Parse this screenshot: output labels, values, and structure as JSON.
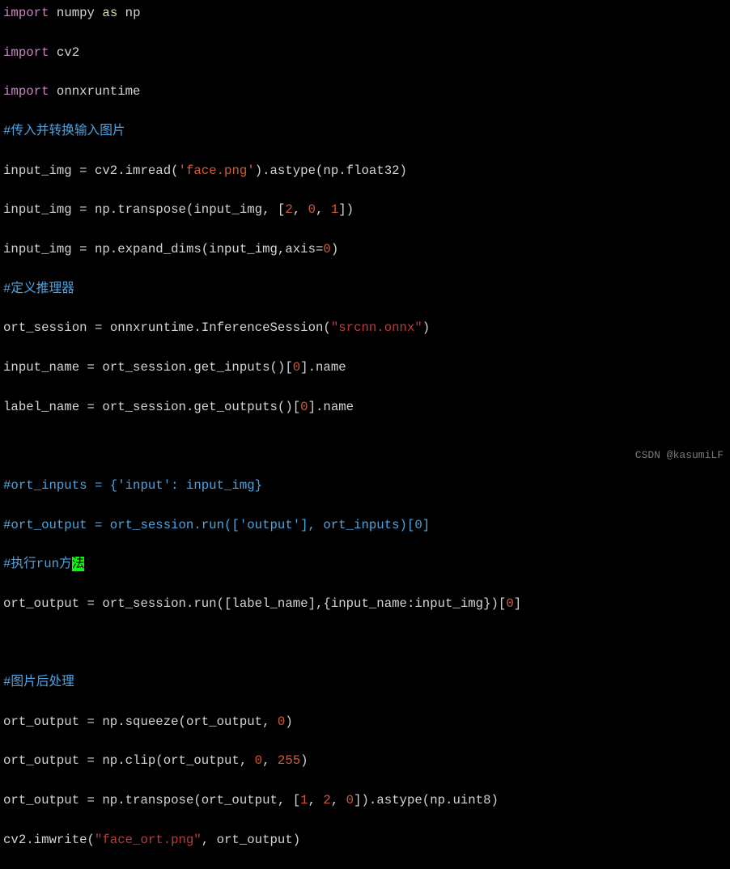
{
  "tokens": {
    "import": "import",
    "as": "as",
    "numpy": "numpy",
    "np": "np",
    "cv2": "cv2",
    "onnxruntime": "onnxruntime",
    "c1": "#传入并转换输入图片",
    "input_img": "input_img",
    "eq": " = ",
    "imread": "cv2.imread(",
    "str_face": "'face.png'",
    "astype": ").astype(np.float32)",
    "transpose_open": "np.transpose(input_img, [",
    "n2": "2",
    "comma": ", ",
    "n0": "0",
    "n1": "1",
    "close_sq": "])",
    "expand_open": "np.expand_dims(input_img,axis=",
    "close_p": ")",
    "c2": "#定义推理器",
    "ort_session": "ort_session",
    "infs_open": "onnxruntime.InferenceSession(",
    "str_srcnn": "\"srcnn.onnx\"",
    "input_name": "input_name",
    "get_inputs": "ort_session.get_inputs()[",
    "name": "].name",
    "label_name": "label_name",
    "get_outputs": "ort_session.get_outputs()[",
    "c3": "#ort_inputs = {'input': input_img}",
    "c4": "#ort_output = ort_session.run(['output'], ort_inputs)[0]",
    "c5a": "#执行run方",
    "c5b": "法",
    "ort_output": "ort_output",
    "run_open": "ort_session.run([label_name],{input_name:input_img})[",
    "close_br": "]",
    "c6": "#图片后处理",
    "squeeze_open": "np.squeeze(ort_output, ",
    "clip_open": "np.clip(ort_output, ",
    "n255": "255",
    "trans2_open": "np.transpose(ort_output, [",
    "astype_u8": "]).astype(np.uint8)",
    "imwrite_open": "cv2.imwrite(",
    "str_faceort": "\"face_ort.png\"",
    "imwrite_close": ", ort_output)"
  },
  "watermark": "CSDN @kasumiLF"
}
